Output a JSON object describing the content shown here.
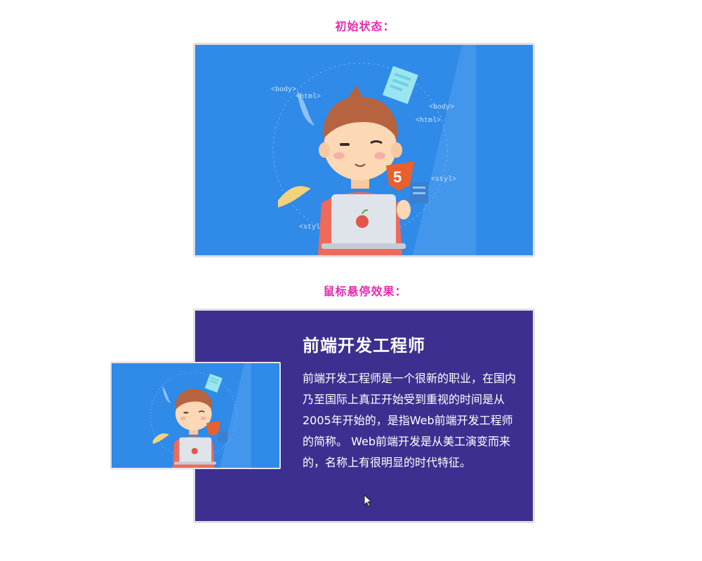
{
  "captions": {
    "initial": "初始状态：",
    "hover": "鼠标悬停效果："
  },
  "illustration": {
    "tags": [
      "<body>",
      "<html>",
      "<body>",
      "<html>",
      "<styl>",
      "<styl>"
    ],
    "badge": "5"
  },
  "hover_card": {
    "title": "前端开发工程师",
    "description": "前端开发工程师是一个很新的职业，在国内乃至国际上真正开始受到重视的时间是从2005年开始的，是指Web前端开发工程师的简称。 Web前端开发是从美工演变而来的，名称上有很明显的时代特征。"
  },
  "colors": {
    "caption": "#e52bb3",
    "illustration_bg": "#2f8ae8",
    "hover_bg": "#3d2f8f",
    "frame_border": "#e0e0e4"
  },
  "icons": [
    "mouse-pointer-icon",
    "html5-badge-icon",
    "laptop-icon",
    "apple-logo-icon"
  ]
}
